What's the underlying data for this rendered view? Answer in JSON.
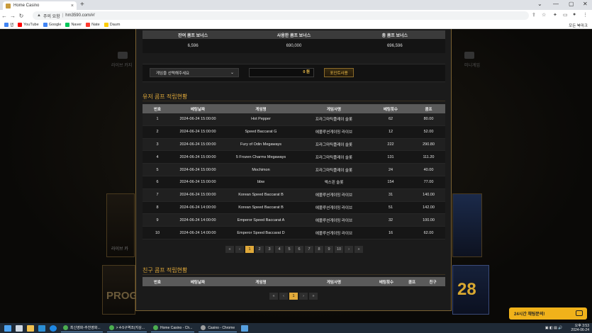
{
  "browser": {
    "tab_title": "Home Casino",
    "tab_close": "×",
    "new_tab": "+",
    "window_controls": [
      "⌄",
      "—",
      "▢",
      "✕"
    ],
    "security_label": "주의 요함",
    "url": "hm3590.com/#/",
    "bookmarks": [
      {
        "label": "앱",
        "color": "#4285f4"
      },
      {
        "label": "YouTube",
        "color": "#ff0000"
      },
      {
        "label": "Google",
        "color": "#ffffff"
      },
      {
        "label": "Naver",
        "color": "#03c75a"
      },
      {
        "label": "Nate",
        "color": "#ff3b30"
      },
      {
        "label": "Daum",
        "color": "#ffcd00"
      }
    ],
    "all_bookmarks": "모든 북마크"
  },
  "background": {
    "left_nav": "라이브 카지",
    "right_nav": "미니게임",
    "left_card": "라이브 카",
    "promo": "PROG",
    "number": "28"
  },
  "comp_bonus": {
    "headers": [
      "잔여 콤프 보너스",
      "사용한 콤프 보너스",
      "총 콤프 보너스"
    ],
    "values": [
      "6,596",
      "690,000",
      "696,596"
    ]
  },
  "convert": {
    "select_placeholder": "게임을 선택해주세요",
    "amount": "0 원",
    "button": "포인트사용"
  },
  "user_comp": {
    "title": "유저 콤프 적립현황",
    "headers": [
      "번호",
      "베팅날짜",
      "게임명",
      "게임사명",
      "베팅횟수",
      "콤프"
    ],
    "rows": [
      [
        "1",
        "2024-06-24 15:00:00",
        "Hot Pepper",
        "프라그마틱플레이 슬롯",
        "62",
        "80.00"
      ],
      [
        "2",
        "2024-06-24 15:00:00",
        "Speed Baccarat G",
        "에볼루션게이밍 라이브",
        "12",
        "52.00"
      ],
      [
        "3",
        "2024-06-24 15:00:00",
        "Fury of Odin Megaways",
        "프라그마틱플레이 슬롯",
        "222",
        "290.80"
      ],
      [
        "4",
        "2024-06-24 15:00:00",
        "5 Frozen Charms Megaways",
        "프라그마틱플레이 슬롯",
        "131",
        "111.20"
      ],
      [
        "5",
        "2024-06-24 15:00:00",
        "Mochimon",
        "프라그마틱플레이 슬롯",
        "24",
        "40.00"
      ],
      [
        "6",
        "2024-06-24 15:00:00",
        "bbw",
        "엑스핀 슬롯",
        "154",
        "77.00"
      ],
      [
        "7",
        "2024-06-24 15:00:00",
        "Korean Speed Baccarat B",
        "에볼루션게이밍 라이브",
        "31",
        "140.00"
      ],
      [
        "8",
        "2024-06-24 14:00:00",
        "Korean Speed Baccarat B",
        "에볼루션게이밍 라이브",
        "51",
        "142.00"
      ],
      [
        "9",
        "2024-06-24 14:00:00",
        "Emperor Speed Baccarat A",
        "에볼루션게이밍 라이브",
        "32",
        "100.00"
      ],
      [
        "10",
        "2024-06-24 14:00:00",
        "Emperor Speed Baccarat D",
        "에볼루션게이밍 라이브",
        "16",
        "62.00"
      ]
    ],
    "pager": [
      "«",
      "‹",
      "1",
      "2",
      "3",
      "4",
      "5",
      "6",
      "7",
      "8",
      "9",
      "10",
      "›",
      "»"
    ]
  },
  "friend_comp": {
    "title": "친구 콤프 적립현황",
    "headers": [
      "번호",
      "베팅날짜",
      "게임명",
      "게임사명",
      "베팅횟수",
      "콤프",
      "친구"
    ],
    "pager": [
      "«",
      "‹",
      "1",
      "›",
      "»"
    ]
  },
  "chat": {
    "label": "24시간 채팅문의!"
  },
  "taskbar": {
    "apps": [
      {
        "label": "최신영화-추천영화...",
        "color": "#4caf50"
      },
      {
        "label": "> 4-5구역조(지상...",
        "color": "#4caf50"
      },
      {
        "label": "Home Casino - Ch...",
        "color": "#4caf50"
      },
      {
        "label": "Casino - Chrome",
        "color": "#9e9e9e"
      }
    ],
    "time": "오후 3:53",
    "date": "2024-06-24"
  }
}
